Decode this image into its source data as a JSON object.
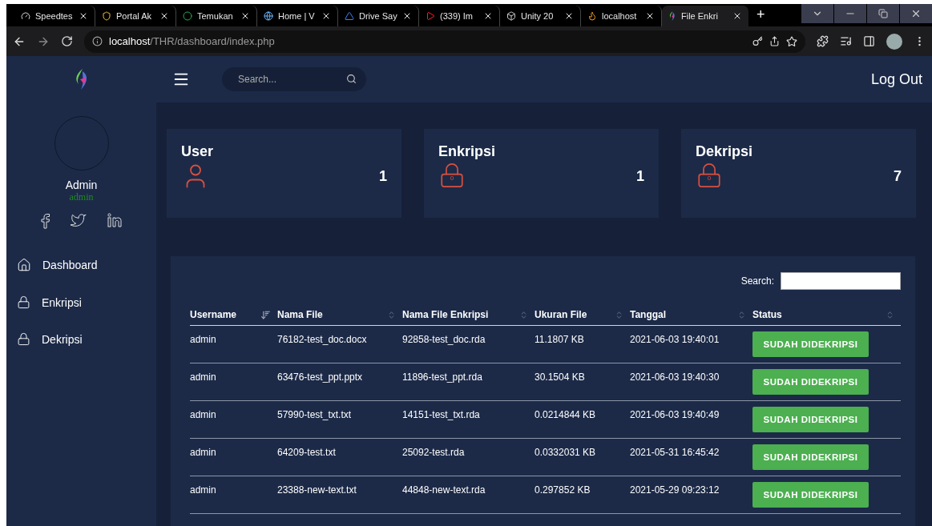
{
  "browser": {
    "tabs": [
      {
        "title": "Speedtes",
        "selected": false
      },
      {
        "title": "Portal Ak",
        "selected": false
      },
      {
        "title": "Temukan",
        "selected": false
      },
      {
        "title": "Home | V",
        "selected": false
      },
      {
        "title": "Drive Say",
        "selected": false
      },
      {
        "title": "(339) Im",
        "selected": false
      },
      {
        "title": "Unity 20",
        "selected": false
      },
      {
        "title": "localhost",
        "selected": false
      },
      {
        "title": "File Enkri",
        "selected": true
      }
    ],
    "new_tab": "+",
    "url": {
      "host": "localhost",
      "path": "/THR/dashboard/index.php"
    }
  },
  "sidebar": {
    "user": {
      "name": "Admin",
      "username": "admin"
    },
    "nav": [
      {
        "label": "Dashboard"
      },
      {
        "label": "Enkripsi"
      },
      {
        "label": "Dekripsi"
      }
    ]
  },
  "header": {
    "search": {
      "placeholder": "Search..."
    },
    "logout": "Log Out"
  },
  "cards": [
    {
      "title": "User",
      "value": "1"
    },
    {
      "title": "Enkripsi",
      "value": "1",
      "icon_text": "0"
    },
    {
      "title": "Dekripsi",
      "value": "7",
      "icon_text": "0"
    }
  ],
  "table": {
    "search_label": "Search:",
    "columns": [
      {
        "label": "Username",
        "sorted": true
      },
      {
        "label": "Nama File",
        "sorted": false
      },
      {
        "label": "Nama File Enkripsi",
        "sorted": false
      },
      {
        "label": "Ukuran File",
        "sorted": false
      },
      {
        "label": "Tanggal",
        "sorted": false
      },
      {
        "label": "Status",
        "sorted": false
      }
    ],
    "rows": [
      {
        "cells": [
          "admin",
          "76182-test_doc.docx",
          "92858-test_doc.rda",
          "11.1807 KB",
          "2021-06-03 19:40:01"
        ],
        "status": "SUDAH DIDEKRIPSI"
      },
      {
        "cells": [
          "admin",
          "63476-test_ppt.pptx",
          "11896-test_ppt.rda",
          "30.1504 KB",
          "2021-06-03 19:40:30"
        ],
        "status": "SUDAH DIDEKRIPSI"
      },
      {
        "cells": [
          "admin",
          "57990-test_txt.txt",
          "14151-test_txt.rda",
          "0.0214844 KB",
          "2021-06-03 19:40:49"
        ],
        "status": "SUDAH DIDEKRIPSI"
      },
      {
        "cells": [
          "admin",
          "64209-test.txt",
          "25092-test.rda",
          "0.0332031 KB",
          "2021-05-31 16:45:42"
        ],
        "status": "SUDAH DIDEKRIPSI"
      },
      {
        "cells": [
          "admin",
          "23388-new-text.txt",
          "44848-new-text.rda",
          "0.297852 KB",
          "2021-05-29 09:23:12"
        ],
        "status": "SUDAH DIDEKRIPSI"
      }
    ]
  }
}
